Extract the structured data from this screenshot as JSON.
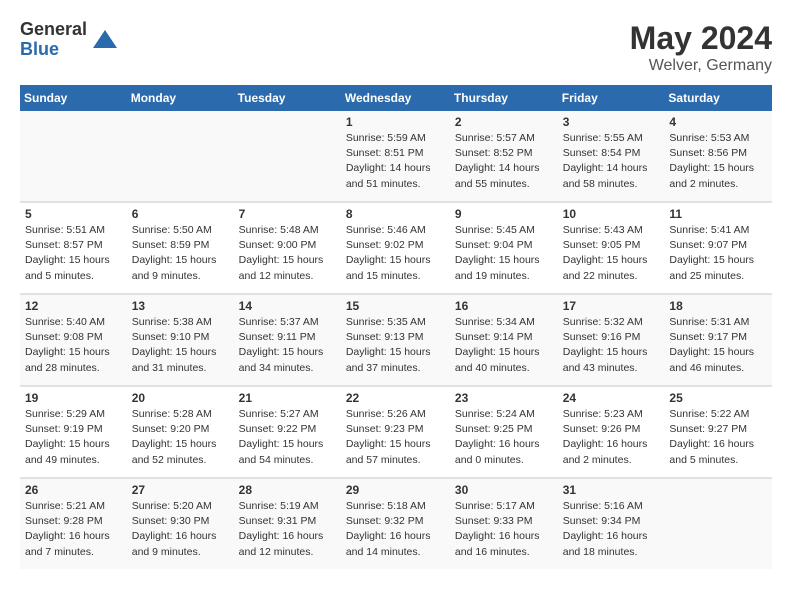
{
  "logo": {
    "general": "General",
    "blue": "Blue"
  },
  "title": "May 2024",
  "location": "Welver, Germany",
  "days_of_week": [
    "Sunday",
    "Monday",
    "Tuesday",
    "Wednesday",
    "Thursday",
    "Friday",
    "Saturday"
  ],
  "weeks": [
    {
      "days": [
        {
          "num": "",
          "sunrise": "",
          "sunset": "",
          "daylight": ""
        },
        {
          "num": "",
          "sunrise": "",
          "sunset": "",
          "daylight": ""
        },
        {
          "num": "",
          "sunrise": "",
          "sunset": "",
          "daylight": ""
        },
        {
          "num": "1",
          "sunrise": "Sunrise: 5:59 AM",
          "sunset": "Sunset: 8:51 PM",
          "daylight": "Daylight: 14 hours and 51 minutes."
        },
        {
          "num": "2",
          "sunrise": "Sunrise: 5:57 AM",
          "sunset": "Sunset: 8:52 PM",
          "daylight": "Daylight: 14 hours and 55 minutes."
        },
        {
          "num": "3",
          "sunrise": "Sunrise: 5:55 AM",
          "sunset": "Sunset: 8:54 PM",
          "daylight": "Daylight: 14 hours and 58 minutes."
        },
        {
          "num": "4",
          "sunrise": "Sunrise: 5:53 AM",
          "sunset": "Sunset: 8:56 PM",
          "daylight": "Daylight: 15 hours and 2 minutes."
        }
      ]
    },
    {
      "days": [
        {
          "num": "5",
          "sunrise": "Sunrise: 5:51 AM",
          "sunset": "Sunset: 8:57 PM",
          "daylight": "Daylight: 15 hours and 5 minutes."
        },
        {
          "num": "6",
          "sunrise": "Sunrise: 5:50 AM",
          "sunset": "Sunset: 8:59 PM",
          "daylight": "Daylight: 15 hours and 9 minutes."
        },
        {
          "num": "7",
          "sunrise": "Sunrise: 5:48 AM",
          "sunset": "Sunset: 9:00 PM",
          "daylight": "Daylight: 15 hours and 12 minutes."
        },
        {
          "num": "8",
          "sunrise": "Sunrise: 5:46 AM",
          "sunset": "Sunset: 9:02 PM",
          "daylight": "Daylight: 15 hours and 15 minutes."
        },
        {
          "num": "9",
          "sunrise": "Sunrise: 5:45 AM",
          "sunset": "Sunset: 9:04 PM",
          "daylight": "Daylight: 15 hours and 19 minutes."
        },
        {
          "num": "10",
          "sunrise": "Sunrise: 5:43 AM",
          "sunset": "Sunset: 9:05 PM",
          "daylight": "Daylight: 15 hours and 22 minutes."
        },
        {
          "num": "11",
          "sunrise": "Sunrise: 5:41 AM",
          "sunset": "Sunset: 9:07 PM",
          "daylight": "Daylight: 15 hours and 25 minutes."
        }
      ]
    },
    {
      "days": [
        {
          "num": "12",
          "sunrise": "Sunrise: 5:40 AM",
          "sunset": "Sunset: 9:08 PM",
          "daylight": "Daylight: 15 hours and 28 minutes."
        },
        {
          "num": "13",
          "sunrise": "Sunrise: 5:38 AM",
          "sunset": "Sunset: 9:10 PM",
          "daylight": "Daylight: 15 hours and 31 minutes."
        },
        {
          "num": "14",
          "sunrise": "Sunrise: 5:37 AM",
          "sunset": "Sunset: 9:11 PM",
          "daylight": "Daylight: 15 hours and 34 minutes."
        },
        {
          "num": "15",
          "sunrise": "Sunrise: 5:35 AM",
          "sunset": "Sunset: 9:13 PM",
          "daylight": "Daylight: 15 hours and 37 minutes."
        },
        {
          "num": "16",
          "sunrise": "Sunrise: 5:34 AM",
          "sunset": "Sunset: 9:14 PM",
          "daylight": "Daylight: 15 hours and 40 minutes."
        },
        {
          "num": "17",
          "sunrise": "Sunrise: 5:32 AM",
          "sunset": "Sunset: 9:16 PM",
          "daylight": "Daylight: 15 hours and 43 minutes."
        },
        {
          "num": "18",
          "sunrise": "Sunrise: 5:31 AM",
          "sunset": "Sunset: 9:17 PM",
          "daylight": "Daylight: 15 hours and 46 minutes."
        }
      ]
    },
    {
      "days": [
        {
          "num": "19",
          "sunrise": "Sunrise: 5:29 AM",
          "sunset": "Sunset: 9:19 PM",
          "daylight": "Daylight: 15 hours and 49 minutes."
        },
        {
          "num": "20",
          "sunrise": "Sunrise: 5:28 AM",
          "sunset": "Sunset: 9:20 PM",
          "daylight": "Daylight: 15 hours and 52 minutes."
        },
        {
          "num": "21",
          "sunrise": "Sunrise: 5:27 AM",
          "sunset": "Sunset: 9:22 PM",
          "daylight": "Daylight: 15 hours and 54 minutes."
        },
        {
          "num": "22",
          "sunrise": "Sunrise: 5:26 AM",
          "sunset": "Sunset: 9:23 PM",
          "daylight": "Daylight: 15 hours and 57 minutes."
        },
        {
          "num": "23",
          "sunrise": "Sunrise: 5:24 AM",
          "sunset": "Sunset: 9:25 PM",
          "daylight": "Daylight: 16 hours and 0 minutes."
        },
        {
          "num": "24",
          "sunrise": "Sunrise: 5:23 AM",
          "sunset": "Sunset: 9:26 PM",
          "daylight": "Daylight: 16 hours and 2 minutes."
        },
        {
          "num": "25",
          "sunrise": "Sunrise: 5:22 AM",
          "sunset": "Sunset: 9:27 PM",
          "daylight": "Daylight: 16 hours and 5 minutes."
        }
      ]
    },
    {
      "days": [
        {
          "num": "26",
          "sunrise": "Sunrise: 5:21 AM",
          "sunset": "Sunset: 9:28 PM",
          "daylight": "Daylight: 16 hours and 7 minutes."
        },
        {
          "num": "27",
          "sunrise": "Sunrise: 5:20 AM",
          "sunset": "Sunset: 9:30 PM",
          "daylight": "Daylight: 16 hours and 9 minutes."
        },
        {
          "num": "28",
          "sunrise": "Sunrise: 5:19 AM",
          "sunset": "Sunset: 9:31 PM",
          "daylight": "Daylight: 16 hours and 12 minutes."
        },
        {
          "num": "29",
          "sunrise": "Sunrise: 5:18 AM",
          "sunset": "Sunset: 9:32 PM",
          "daylight": "Daylight: 16 hours and 14 minutes."
        },
        {
          "num": "30",
          "sunrise": "Sunrise: 5:17 AM",
          "sunset": "Sunset: 9:33 PM",
          "daylight": "Daylight: 16 hours and 16 minutes."
        },
        {
          "num": "31",
          "sunrise": "Sunrise: 5:16 AM",
          "sunset": "Sunset: 9:34 PM",
          "daylight": "Daylight: 16 hours and 18 minutes."
        },
        {
          "num": "",
          "sunrise": "",
          "sunset": "",
          "daylight": ""
        }
      ]
    }
  ]
}
